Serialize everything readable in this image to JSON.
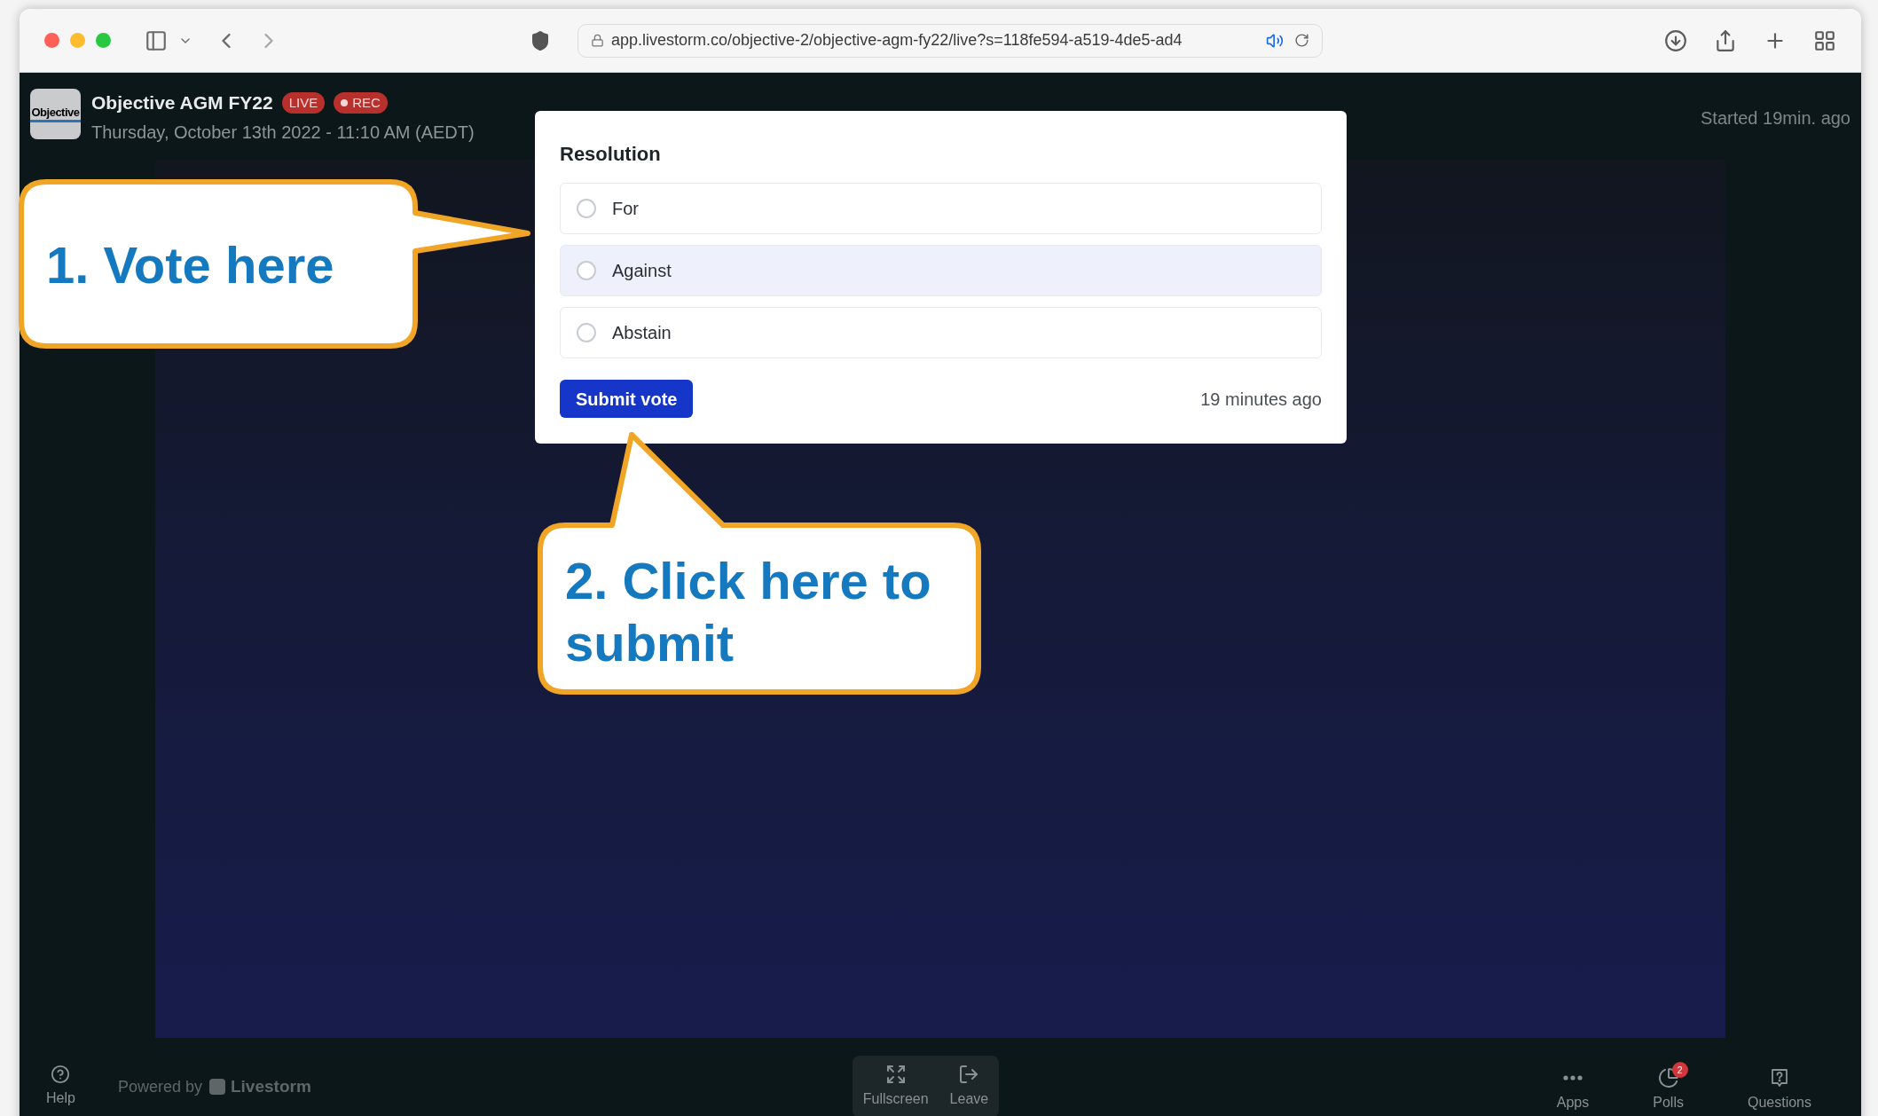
{
  "browser": {
    "url": "app.livestorm.co/objective-2/objective-agm-fy22/live?s=118fe594-a519-4de5-ad4"
  },
  "event": {
    "logo": "Objective",
    "title": "Objective AGM FY22",
    "badges": [
      {
        "label": "LIVE",
        "kind": "live"
      },
      {
        "label": "REC",
        "kind": "rec"
      }
    ],
    "date": "Thursday, October 13th 2022 - 11:10 AM (AEDT)",
    "started": "Started 19min. ago"
  },
  "poll": {
    "question": "Resolution",
    "options": [
      {
        "label": "For",
        "selected": false,
        "hovered": false
      },
      {
        "label": "Against",
        "selected": false,
        "hovered": true
      },
      {
        "label": "Abstain",
        "selected": false,
        "hovered": false
      }
    ],
    "submit": "Submit vote",
    "time": "19 minutes ago"
  },
  "callouts": [
    "1. Vote here",
    "2. Click here to submit"
  ],
  "footer": {
    "help": "Help",
    "powered_by": "Powered by",
    "brand": "Livestorm",
    "center": [
      {
        "label": "Fullscreen",
        "kind": "fullscreen"
      },
      {
        "label": "Leave",
        "kind": "leave"
      }
    ],
    "right": [
      {
        "label": "Apps",
        "kind": "apps"
      },
      {
        "label": "Polls",
        "kind": "polls",
        "badge": "2"
      },
      {
        "label": "Questions",
        "kind": "questions"
      }
    ]
  }
}
